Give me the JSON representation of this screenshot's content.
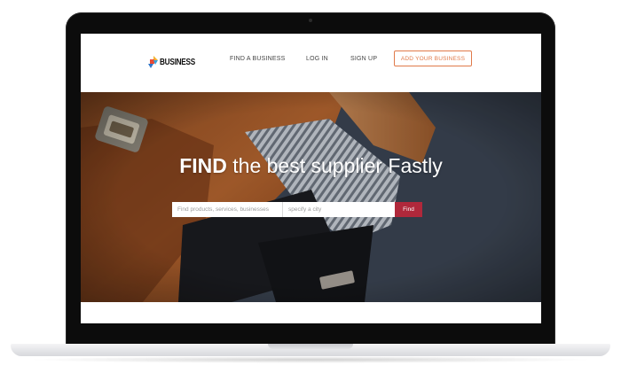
{
  "nav": {
    "logo_text": "BUSINESS",
    "links": [
      {
        "label": "FIND A BUSINESS"
      },
      {
        "label": "LOG IN"
      },
      {
        "label": "SIGN UP"
      }
    ],
    "cta_label": "ADD YOUR BUSINESS",
    "cta_color": "#e07a4a"
  },
  "hero": {
    "title_bold": "FIND",
    "title_rest": " the best supplier Fastly",
    "search_products_placeholder": "Find products, services, businesses",
    "search_city_placeholder": "specify a city",
    "find_label": "Find",
    "find_color": "#b0283b"
  }
}
